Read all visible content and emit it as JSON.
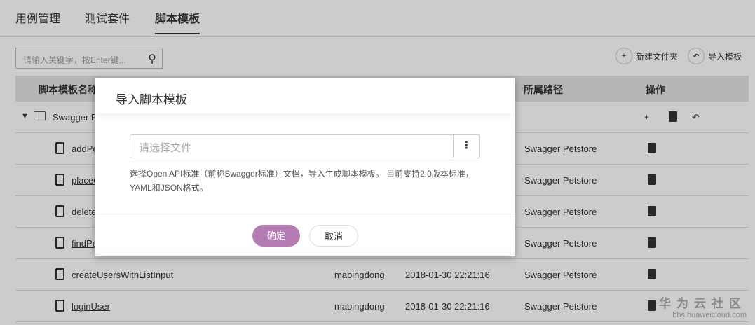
{
  "tabs": [
    "用例管理",
    "测试套件",
    "脚本模板"
  ],
  "search": {
    "placeholder": "请输入关键字，按Enter键..."
  },
  "toolbar": {
    "new_folder": "新建文件夹",
    "import": "导入模板"
  },
  "table": {
    "headers": {
      "name": "脚本模板名称",
      "path": "所属路径",
      "ops": "操作"
    },
    "folder": "Swagger P",
    "rows": [
      {
        "name": "addPe",
        "creator": "",
        "time": "",
        "path": "Swagger Petstore"
      },
      {
        "name": "placeO",
        "creator": "",
        "time": "",
        "path": "Swagger Petstore"
      },
      {
        "name": "delete",
        "creator": "",
        "time": "",
        "path": "Swagger Petstore"
      },
      {
        "name": "findPe",
        "creator": "",
        "time": "",
        "path": "Swagger Petstore"
      },
      {
        "name": "createUsersWithListInput",
        "creator": "mabingdong",
        "time": "2018-01-30 22:21:16",
        "path": "Swagger Petstore"
      },
      {
        "name": "loginUser",
        "creator": "mabingdong",
        "time": "2018-01-30 22:21:16",
        "path": "Swagger Petstore"
      }
    ]
  },
  "modal": {
    "title": "导入脚本模板",
    "file_placeholder": "请选择文件",
    "more": "⋮",
    "description": "选择Open API标准（前称Swagger标准）文档，导入生成脚本模板。 目前支持2.0版本标准，YAML和JSON格式。",
    "ok": "确定",
    "cancel": "取消"
  },
  "watermark": {
    "title": "华为云社区",
    "url": "bbs.huaweicloud.com"
  }
}
